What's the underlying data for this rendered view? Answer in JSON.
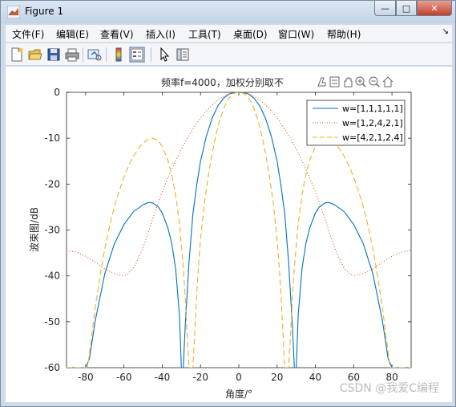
{
  "window": {
    "title": "Figure 1",
    "min_label": "—",
    "max_label": "□",
    "close_label": "✕"
  },
  "menu": {
    "items": [
      "文件(F)",
      "编辑(E)",
      "查看(V)",
      "插入(I)",
      "工具(T)",
      "桌面(D)",
      "窗口(W)",
      "帮助(H)"
    ],
    "overflow": "↘"
  },
  "toolbar": {
    "icons": [
      "new-figure-icon",
      "open-file-icon",
      "save-icon",
      "print-icon",
      "link-plot-icon",
      "colorbar-icon",
      "legend-icon",
      "pointer-icon",
      "property-editor-icon"
    ]
  },
  "axes_toolbar": {
    "icons": [
      "brush-icon",
      "data-tips-icon",
      "pan-icon",
      "zoom-in-icon",
      "zoom-out-icon",
      "home-icon"
    ]
  },
  "watermark": "CSDN @我爱C编程",
  "chart_data": {
    "type": "line",
    "title": "频率f=4000，加权分别取不",
    "xlabel": "角度/°",
    "ylabel": "波束图/dB",
    "xlim": [
      -90,
      90
    ],
    "ylim": [
      -60,
      0
    ],
    "xticks": [
      -80,
      -60,
      -40,
      -20,
      0,
      20,
      40,
      60,
      80
    ],
    "yticks": [
      0,
      -10,
      -20,
      -30,
      -40,
      -50,
      -60
    ],
    "grid": false,
    "legend_position": "top-right",
    "series": [
      {
        "name": "w=[1,1,1,1,1]",
        "style": "solid",
        "color": "#0072bd",
        "x": [
          -90,
          -85,
          -80,
          -78,
          -75,
          -70,
          -65,
          -60,
          -55,
          -50,
          -47,
          -45,
          -42,
          -40,
          -37,
          -35,
          -33,
          -31,
          -30,
          -29,
          -28,
          -26,
          -24,
          -22,
          -20,
          -17,
          -14,
          -11,
          -8,
          -5,
          -3,
          0
        ],
        "y": [
          -60,
          -60,
          -60,
          -58,
          -49.8,
          -39.5,
          -33.0,
          -28.8,
          -26.0,
          -24.5,
          -24.0,
          -24.1,
          -25.0,
          -26.3,
          -29.6,
          -33.0,
          -38.5,
          -48.5,
          -60,
          -60,
          -51.0,
          -36.9,
          -26.5,
          -20.3,
          -15.0,
          -9.6,
          -5.7,
          -3.0,
          -1.3,
          -0.35,
          -0.12,
          0
        ]
      },
      {
        "name": "w=[1,2,4,2,1]",
        "style": "dotted",
        "color": "#d95319",
        "x": [
          -90,
          -85,
          -80,
          -75,
          -70,
          -65,
          -62,
          -60,
          -58,
          -55,
          -52,
          -50,
          -47,
          -45,
          -42,
          -40,
          -37,
          -35,
          -33,
          -30,
          -28,
          -25,
          -22,
          -20,
          -17,
          -14,
          -11,
          -8,
          -5,
          -2,
          0
        ],
        "y": [
          -34.5,
          -34.8,
          -35.7,
          -37.0,
          -38.5,
          -39.5,
          -39.8,
          -39.9,
          -39.6,
          -38.3,
          -35.8,
          -33.8,
          -30.2,
          -27.6,
          -24.0,
          -21.7,
          -18.6,
          -16.7,
          -14.9,
          -12.4,
          -10.8,
          -8.7,
          -6.8,
          -5.6,
          -4.1,
          -2.8,
          -1.7,
          -0.9,
          -0.35,
          -0.05,
          0
        ]
      },
      {
        "name": "w=[4,2,1,2,4]",
        "style": "dashed",
        "color": "#edb120",
        "x": [
          -90,
          -85,
          -80,
          -79,
          -77,
          -75,
          -72,
          -70,
          -67,
          -65,
          -62,
          -60,
          -57,
          -55,
          -52,
          -50,
          -47,
          -45,
          -43,
          -42,
          -40,
          -37,
          -35,
          -33,
          -31,
          -29,
          -28,
          -27,
          -26,
          -25,
          -24,
          -23,
          -22,
          -21,
          -20,
          -18,
          -16,
          -14,
          -12,
          -10,
          -8,
          -6,
          -4,
          -2,
          0
        ],
        "y": [
          -60,
          -60,
          -60,
          -60,
          -53.5,
          -46.9,
          -38.8,
          -34.0,
          -28.2,
          -24.9,
          -20.9,
          -18.5,
          -15.5,
          -13.9,
          -12.0,
          -11.0,
          -10.2,
          -10.0,
          -10.3,
          -10.6,
          -11.8,
          -14.8,
          -18.0,
          -22.4,
          -28.6,
          -38.0,
          -44.6,
          -53.0,
          -60,
          -60,
          -60,
          -52.0,
          -44.0,
          -37.5,
          -32.0,
          -24.2,
          -18.3,
          -13.4,
          -9.4,
          -6.1,
          -3.6,
          -1.8,
          -0.7,
          -0.15,
          0
        ]
      }
    ]
  }
}
